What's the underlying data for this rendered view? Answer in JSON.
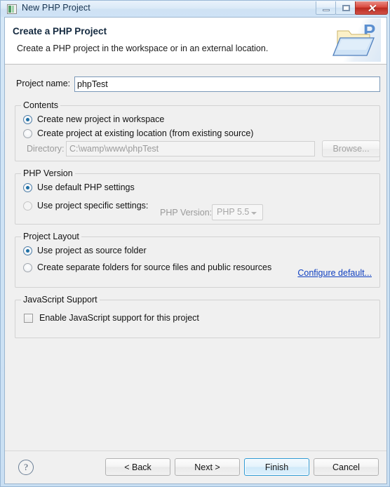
{
  "window": {
    "title": "New PHP Project",
    "icon": "php-project-icon",
    "controls": {
      "minimize": "minimize-icon",
      "maximize": "maximize-icon",
      "close": "✕"
    }
  },
  "header": {
    "title": "Create a PHP Project",
    "description": "Create a PHP project in the workspace or in an external location.",
    "banner_icon": "php-folder-icon"
  },
  "form": {
    "project_name": {
      "label": "Project name:",
      "value": "phpTest",
      "placeholder": ""
    },
    "contents": {
      "legend": "Contents",
      "options": [
        {
          "label": "Create new project in workspace",
          "checked": true
        },
        {
          "label": "Create project at existing location (from existing source)",
          "checked": false
        }
      ],
      "directory": {
        "label": "Directory:",
        "value": "C:\\wamp\\www\\phpTest",
        "browse_label": "Browse...",
        "disabled": true
      }
    },
    "php_version": {
      "legend": "PHP Version",
      "options": [
        {
          "label": "Use default PHP settings",
          "checked": true
        },
        {
          "label": "Use project specific settings:",
          "checked": false
        }
      ],
      "version_label": "PHP Version:",
      "version_value": "PHP 5.5",
      "disabled": true
    },
    "project_layout": {
      "legend": "Project Layout",
      "options": [
        {
          "label": "Use project as source folder",
          "checked": true
        },
        {
          "label": "Create separate folders for source files and public resources",
          "checked": false
        }
      ],
      "configure_link": "Configure default..."
    },
    "javascript_support": {
      "legend": "JavaScript Support",
      "checkbox_label": "Enable JavaScript support for this project",
      "checked": false
    }
  },
  "footer": {
    "help": "?",
    "buttons": [
      {
        "label": "< Back",
        "default": false
      },
      {
        "label": "Next >",
        "default": false
      },
      {
        "label": "Finish",
        "default": true
      },
      {
        "label": "Cancel",
        "default": false
      }
    ]
  },
  "colors": {
    "accent": "#1d6fa5",
    "link": "#0f3fc0",
    "default_button_border": "#2e9ad4",
    "close_button": "#d9473c"
  }
}
